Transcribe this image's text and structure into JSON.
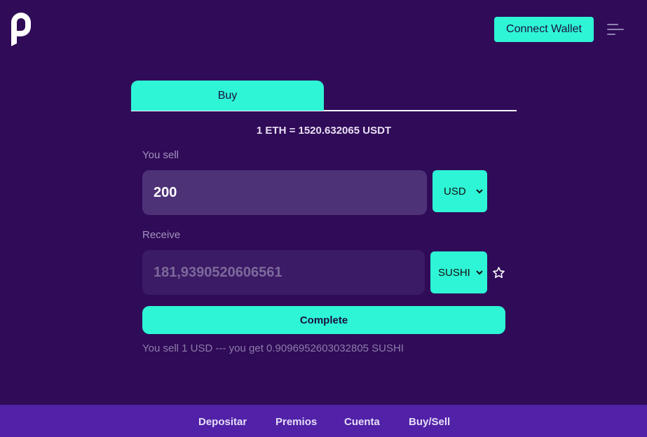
{
  "header": {
    "logo_icon": "p-logo-icon",
    "connect_label": "Connect Wallet",
    "menu_icon": "hamburger-menu-icon"
  },
  "tabs": [
    {
      "label": "Buy",
      "active": true
    }
  ],
  "rate_text": "1 ETH = 1520.632065 USDT",
  "sell": {
    "label": "You sell",
    "value": "200",
    "currency": "USD"
  },
  "receive": {
    "label": "Receive",
    "placeholder": "181,9390520606561",
    "currency": "SUSHI",
    "favorite_icon": "star-icon"
  },
  "complete_label": "Complete",
  "note": "You sell 1 USD --- you get 0.9096952603032805 SUSHI",
  "bottom_nav": [
    {
      "label": "Depositar"
    },
    {
      "label": "Premios"
    },
    {
      "label": "Cuenta"
    },
    {
      "label": "Buy/Sell"
    }
  ],
  "colors": {
    "background": "#300b58",
    "accent": "#2ef5d6",
    "bottom_bar": "#5121a8"
  }
}
